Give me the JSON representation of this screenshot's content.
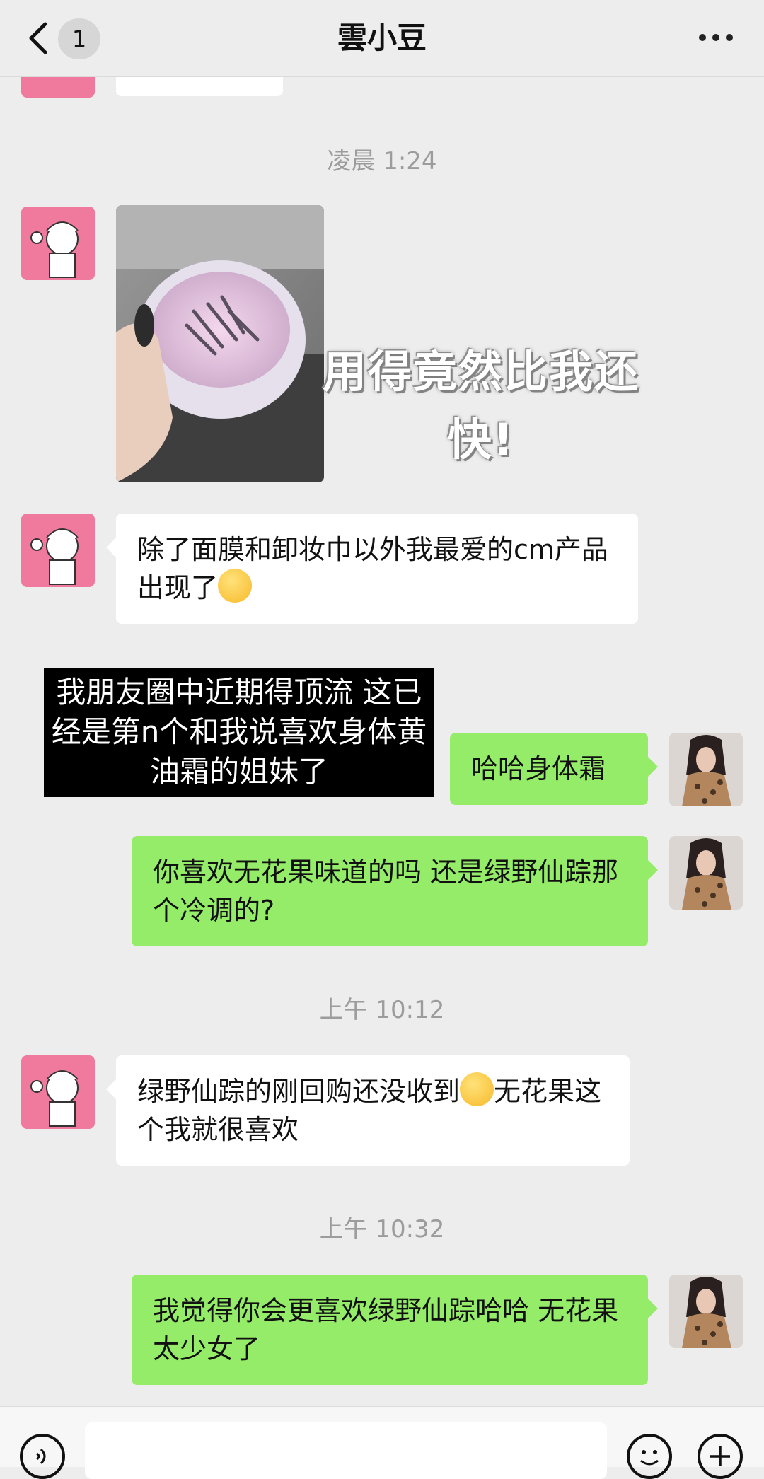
{
  "header": {
    "back_badge": "1",
    "title": "雲小豆"
  },
  "timestamps": {
    "t1": "凌晨 1:24",
    "t2": "上午 10:12",
    "t3": "上午 10:32"
  },
  "overlays": {
    "image_caption": "用得竟然比我还快!",
    "black_caption": "我朋友圈中近期得顶流 这已经是第n个和我说喜欢身体黄油霜的姐妹了"
  },
  "messages": [
    {
      "side": "left",
      "text": "除了面膜和卸妆巾以外我最爱的cm产品出现了"
    },
    {
      "side": "right",
      "text": "哈哈身体霜"
    },
    {
      "side": "right",
      "text": "你喜欢无花果味道的吗 还是绿野仙踪那个冷调的?"
    },
    {
      "side": "left",
      "text_a": "绿野仙踪的刚回购还没收到",
      "text_b": "无花果这个我就很喜欢"
    },
    {
      "side": "right",
      "text": "我觉得你会更喜欢绿野仙踪哈哈 无花果太少女了"
    }
  ],
  "colors": {
    "background": "#ededed",
    "green_bubble": "#95ec69",
    "white_bubble": "#ffffff",
    "timestamp": "#9c9c9c"
  },
  "icons": [
    "back-icon",
    "more-icon",
    "voice-icon",
    "emoji-icon",
    "plus-icon",
    "thinking-emoji"
  ]
}
